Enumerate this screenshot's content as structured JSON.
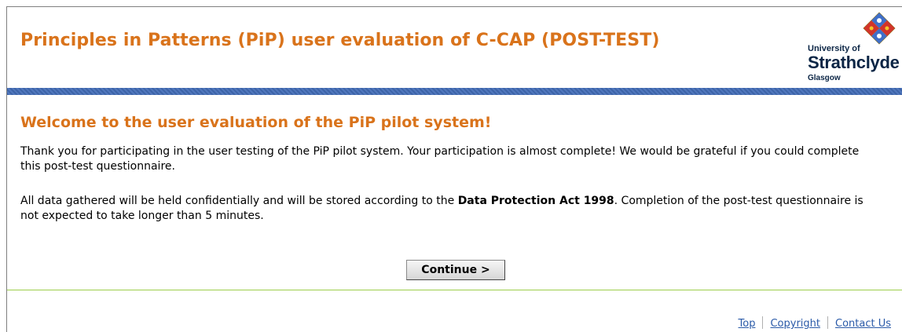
{
  "header": {
    "title": "Principles in Patterns (PiP) user evaluation of C-CAP (POST-TEST)",
    "logo": {
      "line1": "University of",
      "line2": "Strathclyde",
      "line3": "Glasgow"
    }
  },
  "main": {
    "heading": "Welcome to the user evaluation of the PiP pilot system!",
    "paragraph1": "Thank you for participating in the user testing of the PiP pilot system. Your participation is almost complete! We would be grateful if you could complete this post-test questionnaire.",
    "paragraph2_before": "All data gathered will be held confidentially and will be stored according to the ",
    "paragraph2_bold": "Data Protection Act 1998",
    "paragraph2_after": ". Completion of the post-test questionnaire is not expected to take longer than 5 minutes.",
    "continue_label": "Continue >"
  },
  "footer": {
    "links": [
      "Top",
      "Copyright",
      "Contact Us"
    ]
  },
  "colors": {
    "accent_orange": "#d9731b",
    "bar_blue": "#4a70b4",
    "line_green": "#9ccd4b",
    "link_blue": "#2a5aa8"
  }
}
